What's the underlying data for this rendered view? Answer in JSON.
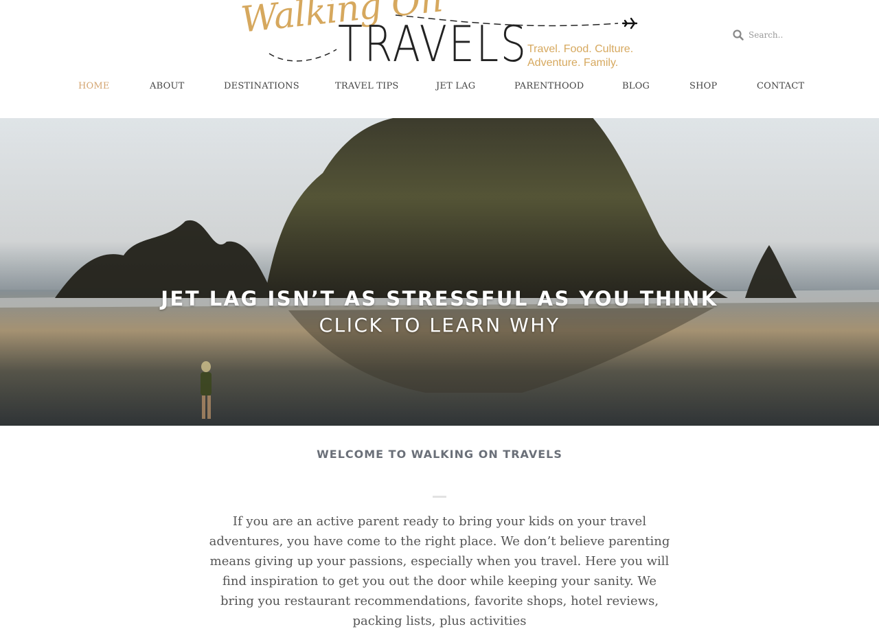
{
  "header": {
    "logo": {
      "script_text": "Walking On",
      "main_text": "TRAVELS",
      "tagline_line1": "Travel. Food. Culture.",
      "tagline_line2": "Adventure. Family.",
      "icon": "airplane-icon",
      "accent_color": "#d6a85e"
    },
    "search": {
      "placeholder": "Search..",
      "icon": "search-icon"
    },
    "nav": [
      {
        "label": "HOME",
        "active": true
      },
      {
        "label": "ABOUT",
        "active": false
      },
      {
        "label": "DESTINATIONS",
        "active": false
      },
      {
        "label": "TRAVEL TIPS",
        "active": false
      },
      {
        "label": "JET LAG",
        "active": false
      },
      {
        "label": "PARENTHOOD",
        "active": false
      },
      {
        "label": "BLOG",
        "active": false
      },
      {
        "label": "SHOP",
        "active": false
      },
      {
        "label": "CONTACT",
        "active": false
      }
    ],
    "active_color": "#d4a571"
  },
  "hero": {
    "title": "JET LAG ISN’T AS STRESSFUL AS YOU THINK",
    "subtitle": "CLICK TO LEARN WHY"
  },
  "welcome": {
    "title": "WELCOME TO WALKING ON TRAVELS",
    "body": "If you are an active parent ready to bring your kids on your travel adventures, you have come to the right place. We don’t believe parenting means giving up your passions, especially when you travel. Here you will find inspiration to get you out the door while keeping your sanity. We bring you restaurant recommendations, favorite shops, hotel reviews, packing lists, plus activities"
  }
}
